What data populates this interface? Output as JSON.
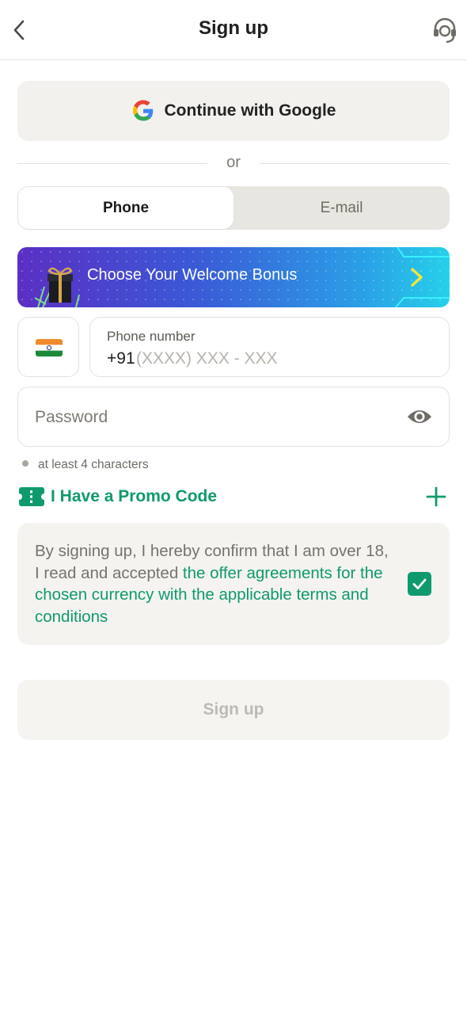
{
  "header": {
    "title": "Sign up"
  },
  "google": {
    "label": "Continue with Google"
  },
  "divider": {
    "text": "or"
  },
  "tabs": [
    {
      "label": "Phone",
      "active": true
    },
    {
      "label": "E-mail",
      "active": false
    }
  ],
  "bonus": {
    "label": "Choose Your Welcome Bonus"
  },
  "phone": {
    "label": "Phone number",
    "prefix": "+91",
    "mask": "(XXXX) XXX - XXX",
    "country": "India"
  },
  "password": {
    "placeholder": "Password"
  },
  "hint": {
    "text": "at least 4 characters"
  },
  "promo": {
    "label": "I Have a Promo Code"
  },
  "terms": {
    "text": "By signing up, I hereby confirm that I am over 18, I read and accepted ",
    "link": "the offer agreements for the chosen currency with the applicable terms and conditions",
    "checked": true
  },
  "submit": {
    "label": "Sign up"
  },
  "colors": {
    "accent": "#0f9a6e",
    "field_border": "#e3e1dc",
    "button_bg": "#f2f1ee"
  }
}
